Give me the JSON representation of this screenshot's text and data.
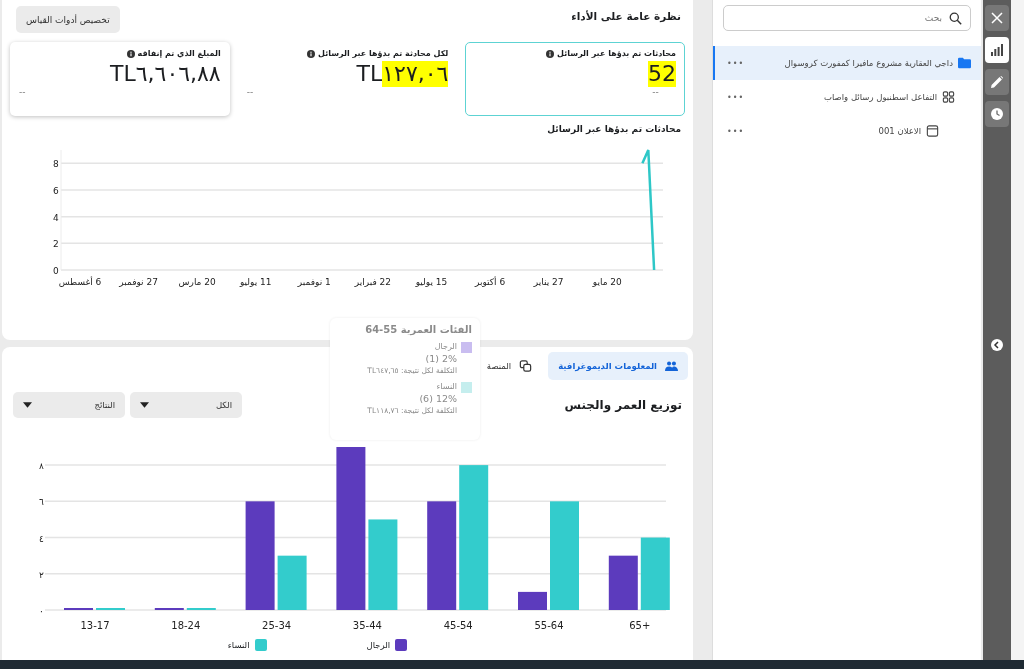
{
  "overview": {
    "title": "نظرة عامة على الأداء",
    "customize_button": "تخصيص أدوات القياس",
    "metrics": [
      {
        "label": "محادثات تم بدؤها عبر الرسائل",
        "value": "52",
        "sub": "--",
        "selected": true,
        "highlighted": true
      },
      {
        "label": "لكل محادثة تم بدؤها عبر الرسائل",
        "currency": "TL",
        "value": "١٢٧,٠٦",
        "sub": "--",
        "selected": false,
        "highlighted": true
      },
      {
        "label": "المبلغ الذي تم إنفاقه",
        "currency": "TL",
        "value": "٦,٦٠٦,٨٨",
        "sub": "--",
        "selected": false,
        "highlighted": false
      }
    ],
    "chart_title": "محادثات تم بدؤها عبر الرسائل",
    "chart_data": {
      "type": "line",
      "grid": true,
      "ylim": [
        0,
        9
      ],
      "yticks": [
        0,
        2,
        4,
        6,
        8
      ],
      "categories": [
        "6 أغسطس",
        null,
        null,
        null,
        null,
        null,
        null,
        null,
        null,
        null,
        "27 نوفمبر",
        null,
        null,
        null,
        null,
        null,
        null,
        null,
        null,
        null,
        "20 مارس",
        null,
        null,
        null,
        null,
        null,
        null,
        null,
        null,
        null,
        "11 يوليو",
        null,
        null,
        null,
        null,
        null,
        null,
        null,
        null,
        null,
        "1 نوفمبر",
        null,
        null,
        null,
        null,
        null,
        null,
        null,
        null,
        null,
        "22 فبراير",
        null,
        null,
        null,
        null,
        null,
        null,
        null,
        null,
        null,
        "15 يوليو",
        null,
        null,
        null,
        null,
        null,
        null,
        null,
        null,
        null,
        "6 أكتوبر",
        null,
        null,
        null,
        null,
        null,
        null,
        null,
        null,
        null,
        "27 يناير",
        null,
        null,
        null,
        null,
        null,
        null,
        null,
        null,
        null,
        "20 مايو",
        null,
        null,
        null,
        null,
        null,
        null,
        null,
        null
      ],
      "series": [
        {
          "color": "#2ec7c7",
          "values": [
            null,
            null,
            null,
            null,
            null,
            null,
            null,
            null,
            null,
            null,
            null,
            null,
            null,
            null,
            null,
            null,
            null,
            null,
            null,
            null,
            null,
            null,
            null,
            null,
            null,
            null,
            null,
            null,
            null,
            null,
            null,
            null,
            null,
            null,
            null,
            null,
            null,
            null,
            null,
            null,
            null,
            null,
            null,
            null,
            null,
            null,
            null,
            null,
            null,
            null,
            null,
            null,
            null,
            null,
            null,
            null,
            null,
            null,
            null,
            null,
            null,
            null,
            null,
            null,
            null,
            null,
            null,
            null,
            null,
            null,
            null,
            null,
            null,
            null,
            null,
            null,
            null,
            null,
            null,
            null,
            null,
            null,
            null,
            null,
            null,
            null,
            null,
            null,
            null,
            null,
            null,
            null,
            null,
            null,
            null,
            null,
            8,
            9,
            0
          ]
        }
      ]
    }
  },
  "demographics": {
    "tabs": [
      {
        "label": "المعلومات الديموغرافية",
        "kind": "people",
        "selected": true
      },
      {
        "label": "المنصة",
        "kind": "platform",
        "selected": false
      }
    ],
    "title": "توزيع العمر والجنس",
    "dropdowns": [
      "الكل",
      "النتائج"
    ],
    "chart_data": {
      "type": "bar",
      "grid": true,
      "ylim": [
        0,
        9
      ],
      "categories": [
        "13-17",
        "18-24",
        "25-34",
        "35-44",
        "45-54",
        "55-64",
        "+65"
      ],
      "yticks": [
        {
          "value": 0,
          "label": "٠"
        },
        {
          "value": 2,
          "label": "٢"
        },
        {
          "value": 4,
          "label": "٤"
        },
        {
          "value": 6,
          "label": "٦"
        },
        {
          "value": 8,
          "label": "٨"
        }
      ],
      "series": [
        {
          "name": "الرجال",
          "color": "#5c3bbd",
          "values": [
            0,
            0,
            6,
            9,
            6,
            1,
            3
          ]
        },
        {
          "name": "النساء",
          "color": "#33cccc",
          "values": [
            0,
            0,
            3,
            5,
            8,
            6,
            4
          ]
        }
      ]
    },
    "tooltip": {
      "title": "الفئات العمرية 55-64",
      "rows": [
        {
          "name": "الرجال",
          "color": "#c9bdf0",
          "share": "2% (1)",
          "cost": "التكلفة لكل نتيجة: TL٦٤٧,٦٥"
        },
        {
          "name": "النساء",
          "color": "#c5eeee",
          "share": "12% (6)",
          "cost": "التكلفة لكل نتيجة: TL١١٨,٧٦"
        }
      ]
    }
  },
  "sidebar": {
    "search": {
      "placeholder": "بحث"
    },
    "items": [
      {
        "label": "داجي العقارية مشروع مافيرا كمفورت كروسوال",
        "kind": "campaign",
        "more": "•••",
        "selected": true,
        "children": [
          {
            "label": "التفاعل اسطنبول رسائل واصاب",
            "kind": "adset",
            "more": "•••",
            "selected": false,
            "children": [
              {
                "label": "الاعلان 001",
                "kind": "ad",
                "more": "•••",
                "selected": false
              }
            ]
          }
        ]
      }
    ]
  },
  "toolbar": [
    {
      "kind": "close",
      "selected": false
    },
    {
      "kind": "chart",
      "selected": true
    },
    {
      "kind": "edit",
      "selected": false
    },
    {
      "kind": "history",
      "selected": false
    }
  ]
}
